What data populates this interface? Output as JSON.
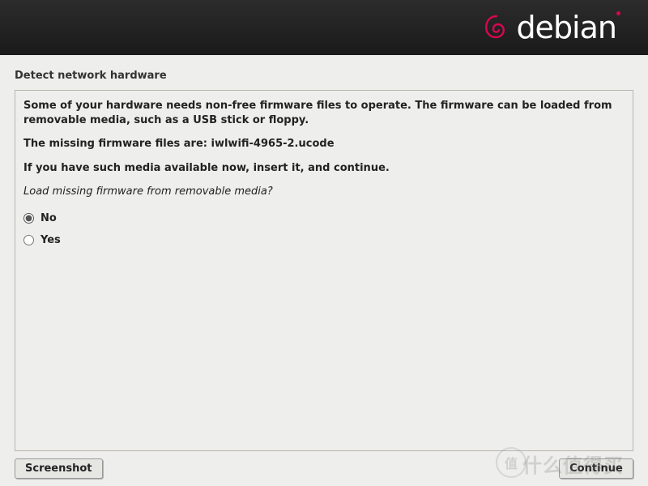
{
  "header": {
    "brand": "debian"
  },
  "page": {
    "title": "Detect network hardware"
  },
  "content": {
    "intro": "Some of your hardware needs non-free firmware files to operate. The firmware can be loaded from removable media, such as a USB stick or floppy.",
    "missing_label": "The missing firmware files are: iwlwifi-4965-2.ucode",
    "instruction": "If you have such media available now, insert it, and continue.",
    "question": "Load missing firmware from removable media?",
    "options": {
      "no": "No",
      "yes": "Yes"
    },
    "selected": "no"
  },
  "buttons": {
    "screenshot": "Screenshot",
    "continue": "Continue"
  },
  "watermark": {
    "text": "什么值得买",
    "badge": "值"
  }
}
